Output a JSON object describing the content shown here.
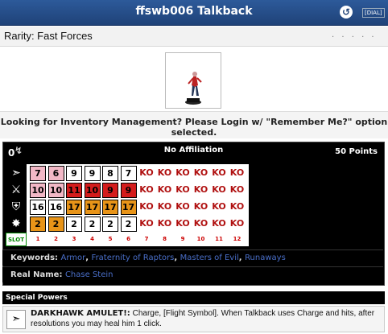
{
  "header": {
    "title": "ffswb006 Talkback",
    "dial_label": "[DIAL]"
  },
  "rarity": {
    "label": "Rarity: Fast Forces",
    "dots": ". . . . ."
  },
  "figure": {
    "alt": "Talkback figure"
  },
  "notice": "Looking for Inventory Management? Please Login w/ \"Remember Me?\" option selected.",
  "dial": {
    "team_points": "0",
    "affiliation": "No Affiliation",
    "points": "50 Points",
    "rows": [
      [
        "7",
        "6",
        "9",
        "9",
        "8",
        "7",
        "KO",
        "KO",
        "KO",
        "KO",
        "KO",
        "KO"
      ],
      [
        "10",
        "10",
        "11",
        "10",
        "9",
        "9",
        "KO",
        "KO",
        "KO",
        "KO",
        "KO",
        "KO"
      ],
      [
        "16",
        "16",
        "17",
        "17",
        "17",
        "17",
        "KO",
        "KO",
        "KO",
        "KO",
        "KO",
        "KO"
      ],
      [
        "2",
        "2",
        "2",
        "2",
        "2",
        "2",
        "KO",
        "KO",
        "KO",
        "KO",
        "KO",
        "KO"
      ]
    ],
    "slots": [
      "1",
      "2",
      "3",
      "4",
      "5",
      "6",
      "7",
      "8",
      "9",
      "10",
      "11",
      "12"
    ],
    "slot_label": "SLOT"
  },
  "keywords": {
    "label": "Keywords:",
    "items": [
      "Armor",
      "Fraternity of Raptors",
      "Masters of Evil",
      "Runaways"
    ]
  },
  "real_name": {
    "label": "Real Name:",
    "value": "Chase Stein"
  },
  "special_powers": {
    "header": "Special Powers",
    "title": "DARKHAWK AMULET!:",
    "text": "Charge, [Flight Symbol]. When Talkback uses Charge and hits, after resolutions you may heal him 1 click."
  }
}
